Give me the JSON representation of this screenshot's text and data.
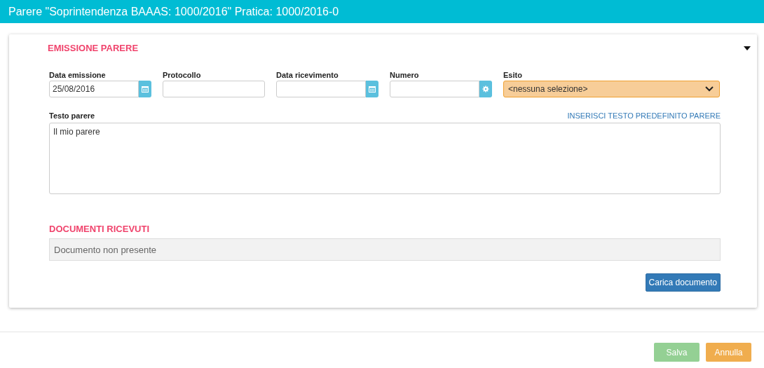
{
  "window": {
    "title": "Parere \"Soprintendenza BAAAS: 1000/2016\" Pratica: 1000/2016-0"
  },
  "section": {
    "title": "EMISSIONE PARERE",
    "expanded": true
  },
  "fields": [
    {
      "kind": "date",
      "label": "Data emissione",
      "value": "25/08/2016"
    },
    {
      "kind": "text",
      "label": "Protocollo"
    },
    {
      "kind": "date",
      "label": "Data ricevimento"
    },
    {
      "kind": "generate",
      "label": "Numero"
    },
    {
      "kind": "select",
      "label": "Esito",
      "value": "<nessuna selezione>"
    }
  ],
  "testo": {
    "label": "Testo parere",
    "link": "INSERISCI TESTO PREDEFINITO PARERE",
    "value": "Il mio parere"
  },
  "documents": {
    "title": "DOCUMENTI RICEVUTI",
    "empty_text": "Documento non presente",
    "upload_button": "Carica documento"
  },
  "buttons": [
    {
      "kind": "save",
      "label": "Salva",
      "disabled": true
    },
    {
      "kind": "cancel",
      "label": "Annulla",
      "disabled": false
    }
  ]
}
